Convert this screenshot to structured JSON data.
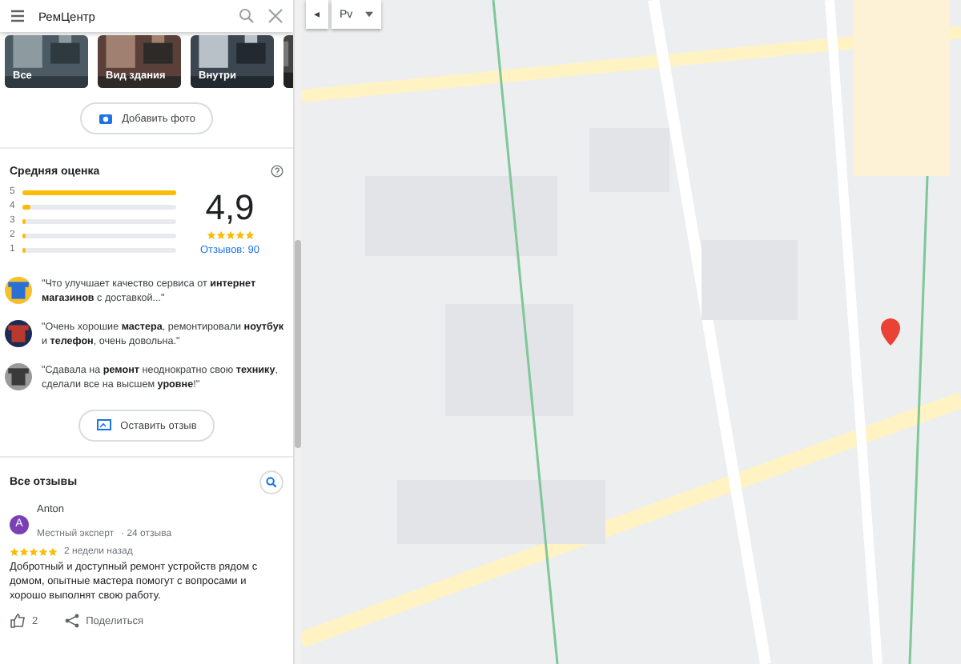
{
  "search": {
    "value": "РемЦентр"
  },
  "photos": [
    {
      "label": "Все"
    },
    {
      "label": "Вид здания"
    },
    {
      "label": "Внутри"
    }
  ],
  "add_photo_button": "Добавить фото",
  "rating": {
    "title": "Средняя оценка",
    "bars": [
      {
        "label": "5",
        "level": 1.0
      },
      {
        "label": "4",
        "level": 0.05
      },
      {
        "label": "3",
        "level": 0.02
      },
      {
        "label": "2",
        "level": 0.01
      },
      {
        "label": "1",
        "level": 0.02
      }
    ],
    "score": "4,9",
    "stars": 5,
    "reviews_link": "Отзывов: 90"
  },
  "snippets": [
    {
      "text": "\"Что улучшает качество сервиса от **интернет магазинов** с доставкой...\""
    },
    {
      "text": "\"Очень хорошие **мастера**, ремонтировали **ноутбук** и **телефон**, очень довольна.\""
    },
    {
      "text": "\"Сдавала на **ремонт** неоднократно свою **технику**, сделали все на высшем **уровне**!\""
    }
  ],
  "write_review_button": "Оставить отзыв",
  "all_reviews": {
    "title": "Все отзывы",
    "reviews": [
      {
        "avatar": "A",
        "author": "Anton",
        "badge": "Местный эксперт",
        "count": "· 24 отзыва",
        "stars": 5,
        "time": "2 недели назад",
        "text": "Добротный и доступный ремонт устройств рядом с домом, опытные мастера помогут с вопросами и хорошо выполнят свою работу.",
        "likes": "2",
        "share": "Поделиться"
      }
    ]
  },
  "map": {
    "kind": "picture",
    "collapse_button": "◂",
    "layer_button": "Рv"
  }
}
